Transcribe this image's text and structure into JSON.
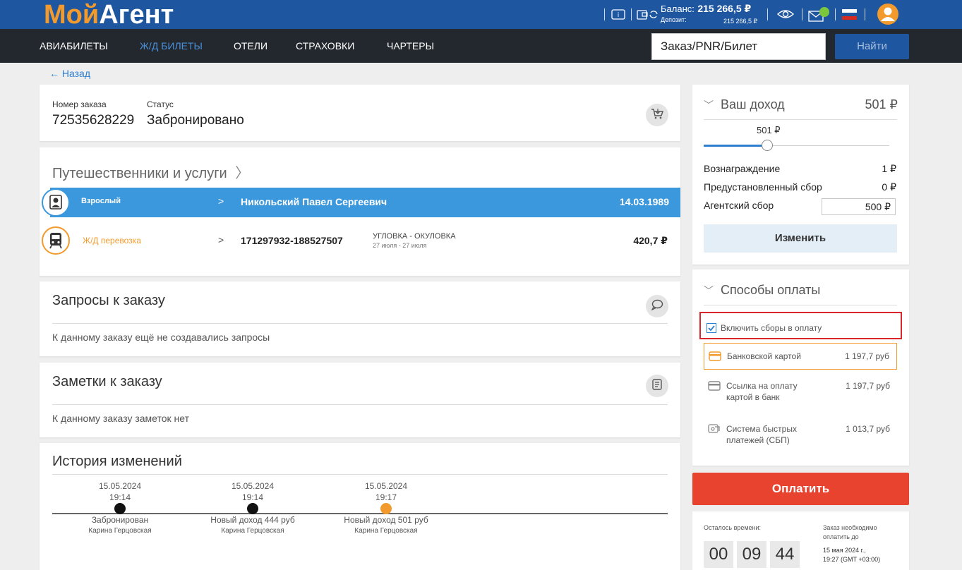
{
  "header": {
    "logo_part1": "Мой",
    "logo_part2": "Агент",
    "balance_label": "Баланс:",
    "balance_value": "215 266,5 ₽",
    "deposit_label": "Депозит:",
    "deposit_value": "215 266,5 ₽"
  },
  "nav": {
    "items": [
      "АВИАБИЛЕТЫ",
      "Ж/Д БИЛЕТЫ",
      "ОТЕЛИ",
      "СТРАХОВКИ",
      "ЧАРТЕРЫ"
    ],
    "active_index": 1,
    "search_value": "Заказ/PNR/Билет",
    "search_button": "Найти"
  },
  "back_link": "← Назад",
  "order": {
    "number_label": "Номер заказа",
    "number_value": "72535628229",
    "status_label": "Статус",
    "status_value": "Забронировано"
  },
  "travelers": {
    "title": "Путешественники и услуги",
    "rows": [
      {
        "type": "Взрослый",
        "name": "Никольский Павел Сергеевич",
        "date": "14.03.1989"
      },
      {
        "type": "Ж/Д перевозка",
        "number": "171297932-188527507",
        "route": "УГЛОВКА - ОКУЛОВКА",
        "dates": "27 июля - 27 июля",
        "price": "420,7 ₽"
      }
    ]
  },
  "requests": {
    "title": "Запросы к заказу",
    "empty": "К данному заказу ещё не создавались запросы"
  },
  "notes": {
    "title": "Заметки к заказу",
    "empty": "К данному заказу заметок нет"
  },
  "history": {
    "title": "История изменений",
    "events": [
      {
        "date": "15.05.2024",
        "time": "19:14",
        "label": "Забронирован",
        "user": "Карина Герцовская",
        "color": "#111111"
      },
      {
        "date": "15.05.2024",
        "time": "19:14",
        "label": "Новый доход 444 руб",
        "user": "Карина Герцовская",
        "color": "#111111"
      },
      {
        "date": "15.05.2024",
        "time": "19:17",
        "label": "Новый доход 501 руб",
        "user": "Карина Герцовская",
        "color": "#f39a2c"
      }
    ]
  },
  "income": {
    "title": "Ваш доход",
    "total": "501 ₽",
    "slider_value": "501 ₽",
    "reward_label": "Вознаграждение",
    "reward_value": "1 ₽",
    "preset_label": "Предустановленный сбор",
    "preset_value": "0 ₽",
    "agent_fee_label": "Агентский сбор",
    "agent_fee_value": "500",
    "agent_fee_currency": "₽",
    "change_button": "Изменить"
  },
  "payment": {
    "title": "Способы оплаты",
    "include_fees_label": "Включить сборы в оплату",
    "include_fees_checked": true,
    "methods": [
      {
        "label": "Банковской картой",
        "amount": "1 197,7 руб"
      },
      {
        "label": "Ссылка на оплату",
        "label2": "картой в банк",
        "amount": "1 197,7 руб"
      },
      {
        "label": "Система быстрых",
        "label2": "платежей (СБП)",
        "amount": "1 013,7 руб"
      }
    ],
    "pay_button": "Оплатить"
  },
  "timer": {
    "remaining_label": "Осталось времени:",
    "hours": "00",
    "minutes": "09",
    "seconds": "44",
    "deadline_label1": "Заказ необходимо",
    "deadline_label2": "оплатить до",
    "deadline_date": "15 мая 2024 г.,",
    "deadline_time": "19:27 (GMT +03:00)"
  },
  "colors": {
    "header_blue": "#1e56a0",
    "nav_dark": "#23272e",
    "accent_orange": "#f39a2c",
    "traveler_row_blue": "#3c98dc",
    "pay_red": "#e8432e",
    "highlight_red": "#d9262b"
  }
}
